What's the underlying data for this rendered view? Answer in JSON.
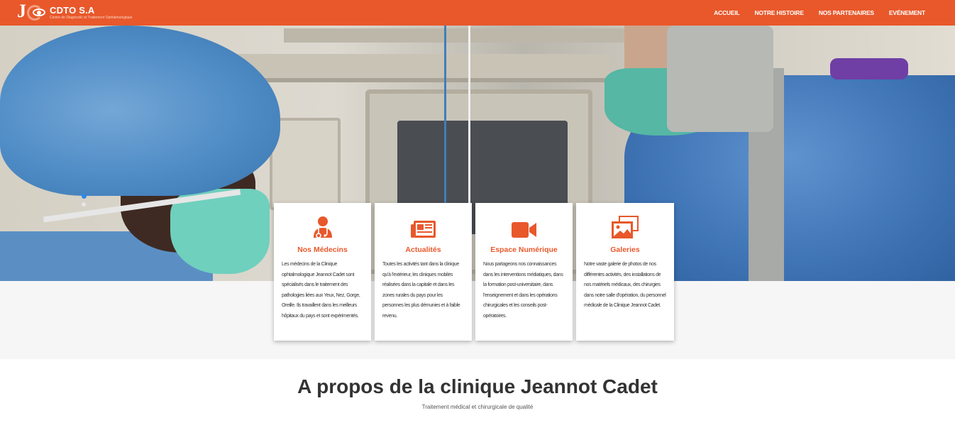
{
  "brand": {
    "logo_letter": "J",
    "name": "CDTO S.A",
    "tagline": "Centre de Diagnostic et Traitement Ophtalmologique"
  },
  "nav": {
    "items": [
      {
        "label": "ACCUEIL"
      },
      {
        "label": "NOTRE HISTOIRE"
      },
      {
        "label": "NOS PARTENAIRES"
      },
      {
        "label": "EVÉNEMENT"
      }
    ]
  },
  "hero": {
    "slide_indicator_active": 0
  },
  "cards": [
    {
      "icon": "doctor-icon",
      "title": "Nos Médecins",
      "text": "Les médecins de la Clinique ophtalmologique Jeannot Cadet sont spécialisés dans le traitement des pathologies liées aux Yeux, Nez, Gorge, Oreille. Ils travaillent dans les meilleurs hôpitaux du pays et sont expérimentés."
    },
    {
      "icon": "newspaper-icon",
      "title": "Actualités",
      "text": "Toutes les activités tant dans la clinique qu'à l'extérieur, les cliniques mobiles réalisées dans la capitale et dans les zones rurales du pays pour les personnes les plus démunies et à faible revenu."
    },
    {
      "icon": "video-camera-icon",
      "title": "Espace Numérique",
      "text": "Nous partageons nos connaissances dans les interventions médiatiques, dans la formation post-universitaire, dans l'enseignement et dans les opérations chirurgicales et les conseils post-opératoires."
    },
    {
      "icon": "photo-gallery-icon",
      "title": "Galeries",
      "text": "Notre vaste galerie de photos de nos différentes activités, des installations de nos matériels médicaux, des chirurgies dans notre salle d'opération, du personnel médicale de la Clinique Jeannot Cadet."
    }
  ],
  "about": {
    "title": "A propos de la clinique Jeannot Cadet",
    "subtitle": "Traitement médical et chirurgicale de qualité"
  },
  "colors": {
    "accent": "#e8582b",
    "text": "#333333",
    "band": "#f6f6f6"
  }
}
